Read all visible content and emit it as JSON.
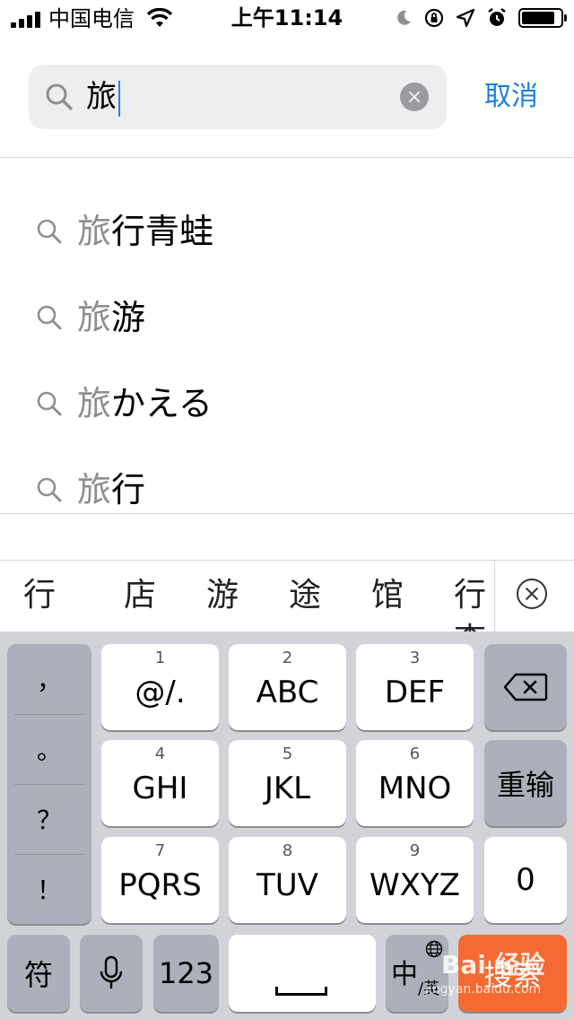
{
  "status_bar": {
    "carrier": "中国电信",
    "time": "上午11:14"
  },
  "search": {
    "query": "旅",
    "cancel_label": "取消"
  },
  "suggestions": [
    {
      "highlight": "旅",
      "rest": "行青蛙"
    },
    {
      "highlight": "旅",
      "rest": "游"
    },
    {
      "highlight": "旅",
      "rest": "かえる"
    },
    {
      "highlight": "旅",
      "rest": "行"
    }
  ],
  "candidates": [
    "行",
    "店",
    "游",
    "途",
    "馆",
    "行李"
  ],
  "keyboard": {
    "punctuation": [
      "，",
      "。",
      "？",
      "！"
    ],
    "keys": [
      {
        "num": "1",
        "label": "@/."
      },
      {
        "num": "2",
        "label": "ABC"
      },
      {
        "num": "3",
        "label": "DEF"
      },
      {
        "num": "4",
        "label": "GHI"
      },
      {
        "num": "5",
        "label": "JKL"
      },
      {
        "num": "6",
        "label": "MNO"
      },
      {
        "num": "7",
        "label": "PQRS"
      },
      {
        "num": "8",
        "label": "TUV"
      },
      {
        "num": "9",
        "label": "WXYZ"
      }
    ],
    "reinput_label": "重输",
    "zero_label": "0",
    "symbols_label": "符",
    "numbers_label": "123",
    "lang_main": "中",
    "lang_sub": "/英",
    "search_label": "搜索"
  },
  "watermark": {
    "brand": "Bai 经验",
    "url": "jingyan.baidu.com"
  },
  "icons": {
    "search": "magnifier-icon",
    "clear": "clear-x-circle-icon",
    "microphone": "microphone-icon",
    "globe": "globe-icon",
    "backspace": "backspace-icon"
  },
  "colors": {
    "accent": "#1a82e0",
    "search_key": "#f46a32",
    "keyboard_bg": "#d1d3d9",
    "gray_key": "#acb0ba"
  }
}
